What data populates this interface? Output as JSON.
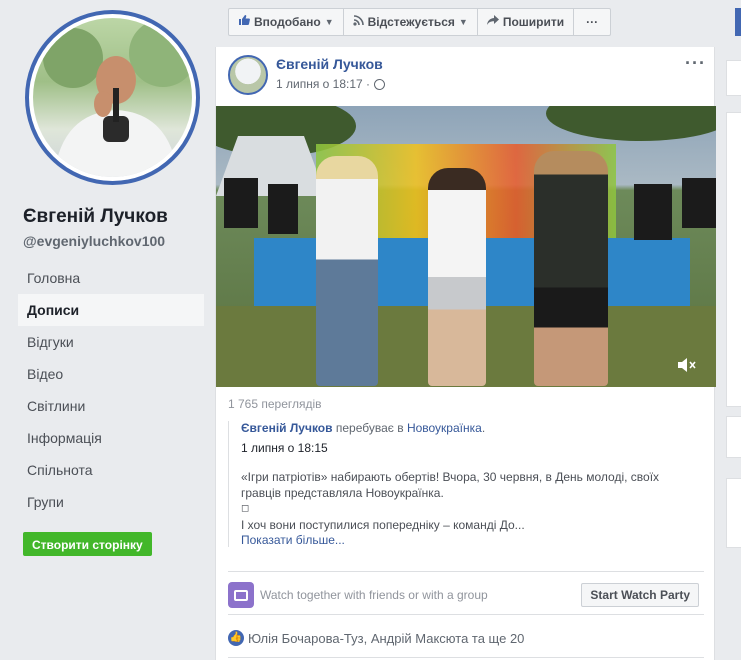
{
  "page": {
    "name": "Євгеній Лучков",
    "handle": "@evgeniyluchkov100",
    "create_page_label": "Створити сторінку"
  },
  "nav": {
    "items": [
      {
        "label": "Головна",
        "active": false
      },
      {
        "label": "Дописи",
        "active": true
      },
      {
        "label": "Відгуки",
        "active": false
      },
      {
        "label": "Відео",
        "active": false
      },
      {
        "label": "Світлини",
        "active": false
      },
      {
        "label": "Інформація",
        "active": false
      },
      {
        "label": "Спільнота",
        "active": false
      },
      {
        "label": "Групи",
        "active": false
      }
    ]
  },
  "actionbar": {
    "liked_label": "Вподобано",
    "follow_label": "Відстежується",
    "share_label": "Поширити",
    "more_label": "···"
  },
  "post": {
    "author": "Євгеній Лучков",
    "time": "1 липня о 18:17 ·",
    "more_label": "···",
    "views": "1 765 переглядів",
    "shared": {
      "author": "Євгеній Лучков",
      "location_prefix": "перебуває в",
      "location": "Новоукраїнка",
      "location_suffix": ".",
      "time": "1 липня о 18:15",
      "text_line1": "«Ігри патріотів» набирають обертів! Вчора, 30 червня, в День молоді, своїх",
      "text_line2": "гравців представляла Новоукраїнка.",
      "text_line3": "◻",
      "text_line4": "І хоч вони поступилися попередніку – команді До...",
      "see_more": "Показати більше..."
    },
    "watch_party": {
      "text": "Watch together with friends or with a group",
      "button": "Start Watch Party"
    },
    "likes": "Юлія Бочарова-Туз, Андрій Максюта та ще 20"
  },
  "colors": {
    "accent": "#4267b2",
    "link": "#365899",
    "create_button": "#42b72a",
    "background": "#e9ebee"
  }
}
